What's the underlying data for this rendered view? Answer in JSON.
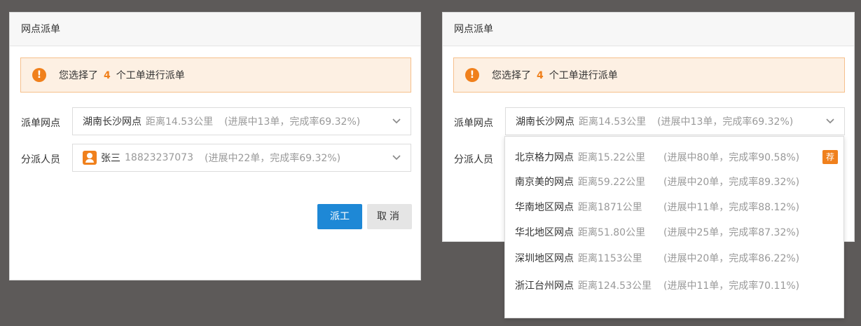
{
  "left_dialog": {
    "title": "网点派单",
    "alert": {
      "prefix": "您选择了",
      "count": "4",
      "suffix": "个工单进行派单"
    },
    "branch_label": "派单网点",
    "branch": {
      "name": "湖南长沙网点",
      "distance": "距离14.53公里",
      "stats": "(进展中13单，完成率69.32%)"
    },
    "staff_label": "分派人员",
    "staff": {
      "name": "张三",
      "phone": "18823237073",
      "stats": "(进展中22单，完成率69.32%)"
    },
    "dispatch_button": "派工",
    "cancel_button": "取消"
  },
  "right_dialog": {
    "title": "网点派单",
    "alert": {
      "prefix": "您选择了",
      "count": "4",
      "suffix": "个工单进行派单"
    },
    "branch_label": "派单网点",
    "branch": {
      "name": "湖南长沙网点",
      "distance": "距离14.53公里",
      "stats": "(进展中13单，完成率69.32%)"
    },
    "staff_label": "分派人员",
    "dropdown": [
      {
        "name": "北京格力网点",
        "distance": "距离15.22公里",
        "stats": "(进展中80单，完成率90.58%)",
        "badge": "荐"
      },
      {
        "name": "南京美的网点",
        "distance": "距离59.22公里",
        "stats": "(进展中20单，完成率89.32%)"
      },
      {
        "name": "华南地区网点",
        "distance": "距离1871公里",
        "stats": "(进展中11单，完成率88.12%)"
      },
      {
        "name": "华北地区网点",
        "distance": "距离51.80公里",
        "stats": "(进展中25单，完成率87.32%)"
      },
      {
        "name": "深圳地区网点",
        "distance": "距离1153公里",
        "stats": "(进展中20单，完成率86.22%)"
      },
      {
        "name": "浙江台州网点",
        "distance": "距离124.53公里",
        "stats": "(进展中11单，完成率70.11%)"
      }
    ]
  },
  "colors": {
    "accent": "#f0801c",
    "primary": "#1e88d6",
    "backdrop": "#5d5a59"
  },
  "icons": {
    "alert": "exclamation-circle-icon",
    "user": "user-badge-icon",
    "chevron": "chevron-down-icon"
  }
}
